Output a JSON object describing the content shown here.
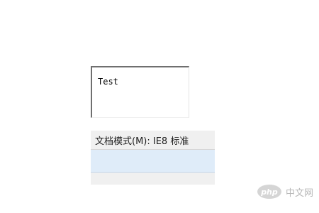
{
  "textarea": {
    "value": "Test"
  },
  "devtools": {
    "document_mode_label": "文档模式(M): IE8 标准"
  },
  "watermark": {
    "badge_text": "php",
    "site_text": "中文网"
  },
  "colors": {
    "selected_row": "#dfecf9",
    "panel_background": "#f0f0f0"
  }
}
